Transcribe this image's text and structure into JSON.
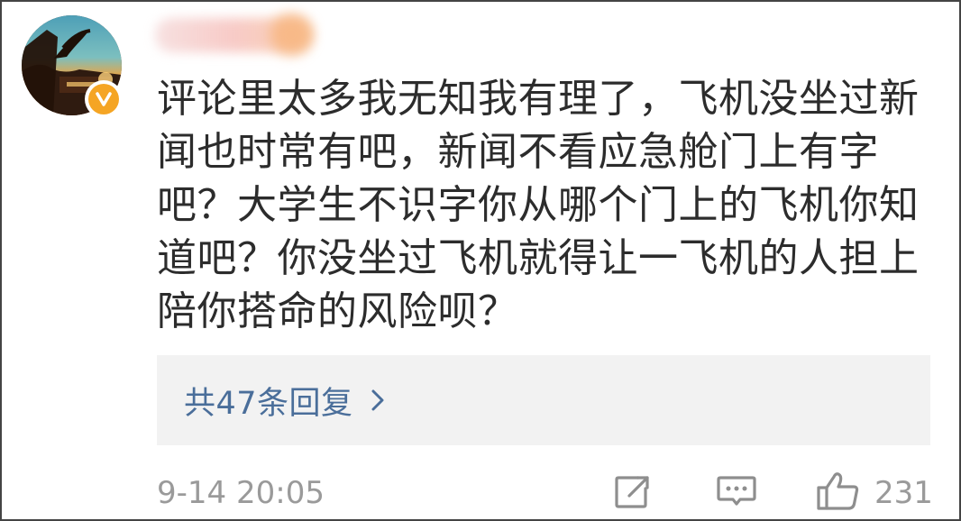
{
  "comment": {
    "text": "评论里太多我无知我有理了，飞机没坐过新\n闻也时常有吧，新闻不看应急舱门上有字\n吧？大学生不识字你从哪个门上的飞机你知\n道吧？你没坐过飞机就得让一飞机的人担上\n陪你搭命的风险呗？",
    "replies_label": "共47条回复",
    "timestamp": "9-14 20:05",
    "like_count": "231"
  },
  "colors": {
    "link": "#4a6e9a",
    "muted": "#9a9a9a",
    "badge": "#f5a524",
    "reply_bg": "#f2f2f2"
  },
  "icons": {
    "verified": "verified-v-icon",
    "chevron": "chevron-right-icon",
    "repost": "repost-icon",
    "comment": "comment-icon",
    "like": "thumbs-up-icon"
  }
}
